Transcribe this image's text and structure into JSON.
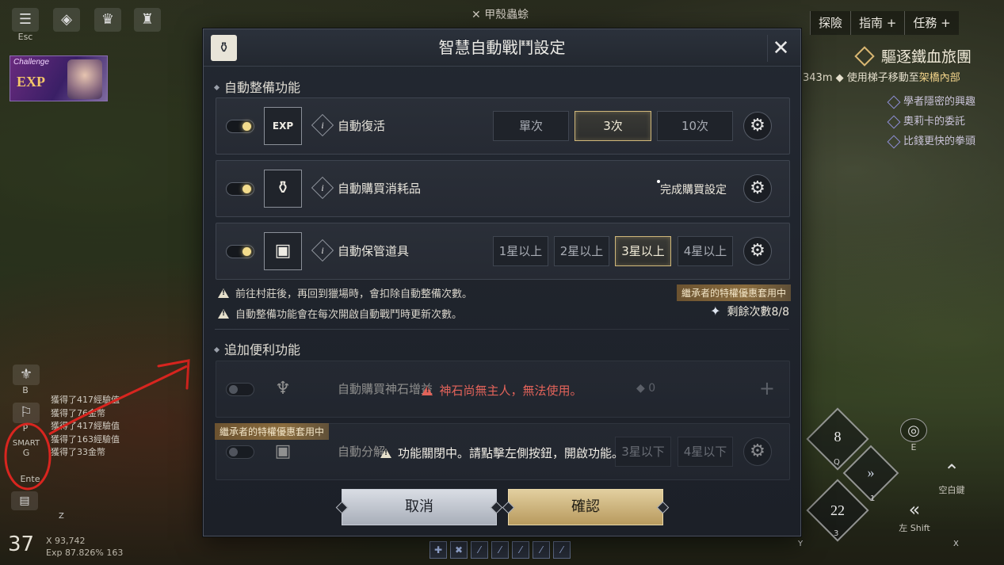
{
  "hud_left": {
    "top_icons": [
      {
        "name": "menu-icon",
        "key": "Esc"
      },
      {
        "name": "bag-icon",
        "key": ""
      },
      {
        "name": "trophy-icon",
        "key": ""
      },
      {
        "name": "castle-icon",
        "key": ""
      }
    ],
    "challenge": {
      "tag": "Challenge",
      "label": "EXP"
    },
    "side_icons": [
      {
        "name": "guild-icon",
        "key": "B"
      },
      {
        "name": "codex-icon",
        "key": "P"
      },
      {
        "name": "smart-icon",
        "label": "SMART",
        "key": "G"
      },
      {
        "name": "enter-icon",
        "key": "Ente"
      }
    ],
    "log": [
      "獲得了417經驗值",
      "獲得了76金幣",
      "獲得了417經驗值",
      "獲得了163經驗值",
      "獲得了33金幣"
    ],
    "level": "37",
    "stats": [
      "X 93,742",
      "Exp 87.826% 163"
    ],
    "chat_key": "Z"
  },
  "top_center": {
    "label": "甲殼蟲蜍"
  },
  "hud_right": {
    "nav": [
      "探險",
      "指南 +",
      "任務 +"
    ],
    "quest_title": "驅逐鐵血旅團",
    "quest_sub_prefix": "343m",
    "quest_sub_text": "使用梯子移動至",
    "quest_sub_highlight": "架橋內部",
    "quests": [
      "學者隱密的興趣",
      "奧莉卡的委託",
      "比錢更快的拳頭"
    ],
    "skills": [
      {
        "value": "8",
        "key": "Q"
      },
      {
        "value": "22",
        "key": "3"
      }
    ],
    "keys": [
      "E",
      "空白鍵",
      "左 Shift",
      "X",
      "Y",
      "1"
    ]
  },
  "dialog": {
    "title": "智慧自動戰鬥設定",
    "section1": "自動整備功能",
    "rows": [
      {
        "label": "自動復活",
        "icon": "EXP",
        "options": [
          "單次",
          "3次",
          "10次"
        ],
        "selected": 1,
        "toggle": "on"
      },
      {
        "label": "自動購買消耗品",
        "icon": "potion",
        "link": "完成購買設定",
        "toggle": "on"
      },
      {
        "label": "自動保管道具",
        "icon": "chest",
        "options": [
          "1星以上",
          "2星以上",
          "3星以上",
          "4星以上"
        ],
        "selected": 2,
        "toggle": "on"
      }
    ],
    "notes": [
      "前往村莊後，再回到獵場時，會扣除自動整備次數。",
      "自動整備功能會在每次開啟自動戰鬥時更新次數。"
    ],
    "heir_badge": "繼承者的特權優惠套用中",
    "remaining": "剩餘次數8/8",
    "section2": "追加便利功能",
    "disabled_rows": [
      {
        "label": "自動購買神石增益",
        "count": "0",
        "message": "神石尚無主人，無法使用。"
      },
      {
        "label": "自動分解",
        "options": [
          "3星以下",
          "4星以下"
        ],
        "message": "功能關閉中。請點擊左側按鈕，開啟功能。"
      }
    ],
    "cancel": "取消",
    "confirm": "確認"
  },
  "quickbar": [
    "✚",
    "✖",
    "⁄",
    "⁄",
    "⁄",
    "⁄",
    "⁄"
  ],
  "colors": {
    "accent_gold": "#cfb77a",
    "warning_red": "#e2635a",
    "annotation_red": "#d8251f"
  }
}
